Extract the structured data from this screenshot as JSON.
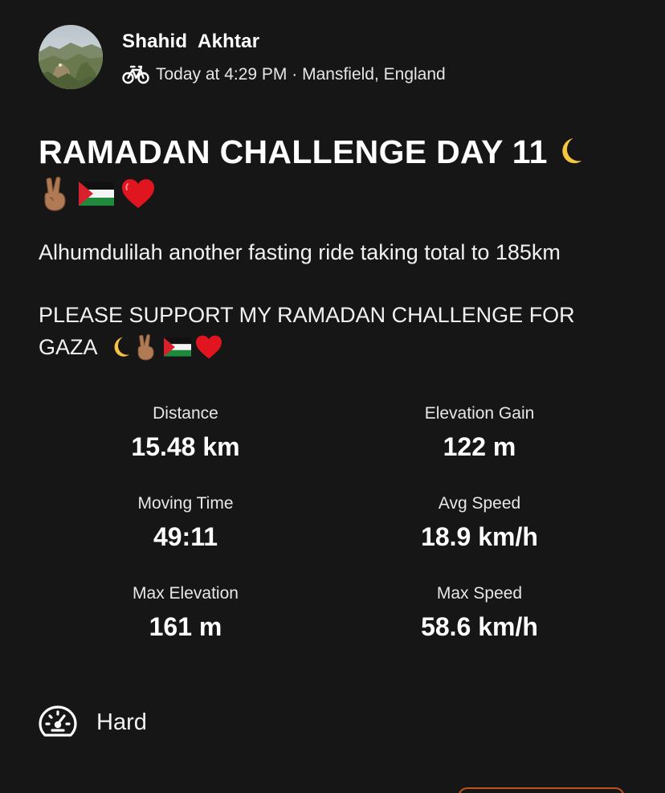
{
  "athlete": {
    "name": "Shahid  Akhtar",
    "activity_meta": "Today at 4:29 PM · Mansfield, England",
    "activity_type_icon": "bike-icon"
  },
  "activity": {
    "title": "RAMADAN CHALLENGE DAY 11",
    "description_line1": "Alhumdulilah another fasting ride taking total to 185km",
    "description_line2": "PLEASE SUPPORT MY RAMADAN CHALLENGE FOR",
    "description_line3": "GAZA"
  },
  "stats": [
    {
      "label": "Distance",
      "value": "15.48 km"
    },
    {
      "label": "Elevation Gain",
      "value": "122 m"
    },
    {
      "label": "Moving Time",
      "value": "49:11"
    },
    {
      "label": "Avg Speed",
      "value": "18.9 km/h"
    },
    {
      "label": "Max Elevation",
      "value": "161 m"
    },
    {
      "label": "Max Speed",
      "value": "58.6 km/h"
    }
  ],
  "effort": {
    "icon": "gauge-icon",
    "label": "Hard"
  },
  "colors": {
    "background": "#161616",
    "text": "#ffffff",
    "accent": "#c0521d"
  }
}
